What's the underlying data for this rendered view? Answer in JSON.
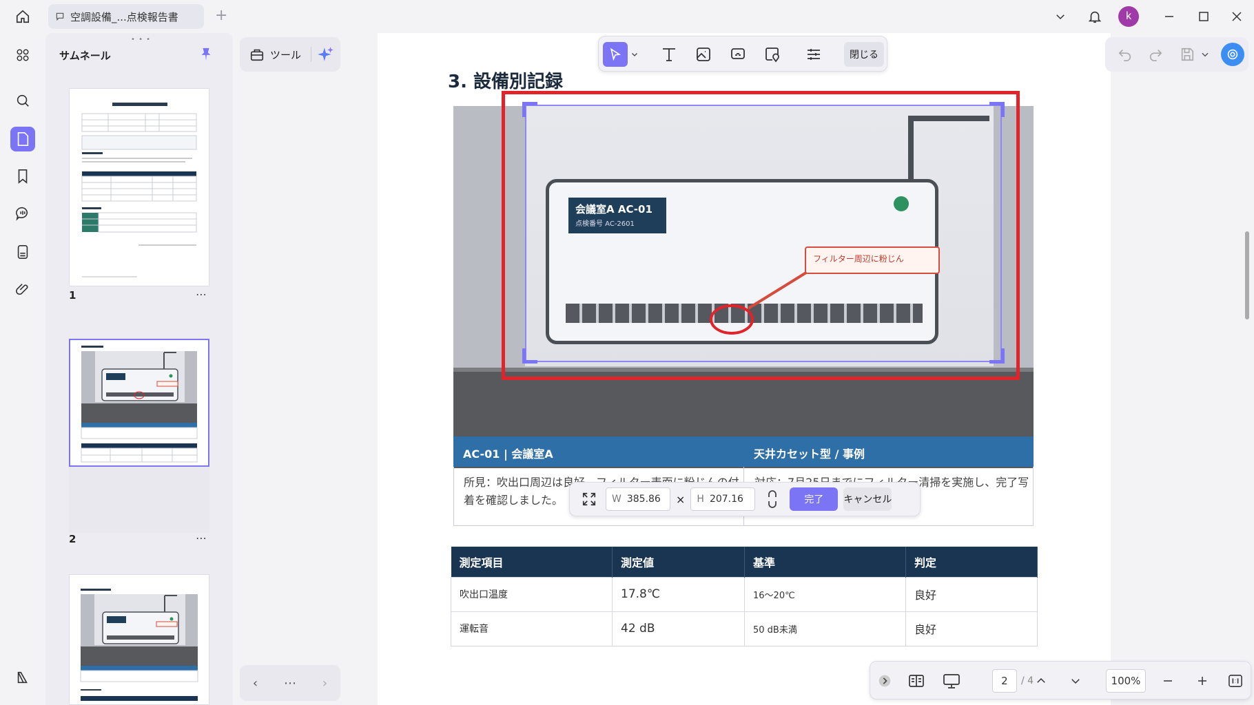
{
  "titlebar": {
    "tab_title": "空調設備_...点検報告書",
    "avatar_letter": "k"
  },
  "thumbnails": {
    "title": "サムネール",
    "pages": [
      {
        "num": "1"
      },
      {
        "num": "2"
      }
    ]
  },
  "tools": {
    "label": "ツール"
  },
  "edit_toolbar": {
    "close_label": "閉じる"
  },
  "document": {
    "section_title": "3.  設備別記録",
    "ac_label_title": "会議室A  AC-01",
    "ac_label_sub": "点検番号  AC-2601",
    "callout": "フィルター周辺に粉じん",
    "record": {
      "head_left": "AC-01 | 会議室A",
      "head_right": "天井カセット型 / 事例",
      "finding": "所見：吹出口周辺は良好。フィルター表面に粉じんの付着を確認しました。",
      "action": "対応：7月25日までにフィルター清掃を実施し、完了写真を台帳へ登録します。"
    },
    "measurements": {
      "headers": [
        "測定項目",
        "測定値",
        "基準",
        "判定"
      ],
      "rows": [
        [
          "吹出口温度",
          "17.8℃",
          "16〜20℃",
          "良好"
        ],
        [
          "運転音",
          "42 dB",
          "50 dB未満",
          "良好"
        ]
      ]
    }
  },
  "resize": {
    "w_key": "W",
    "w_value": "385.86",
    "h_key": "H",
    "h_value": "207.16",
    "times": "×",
    "done_label": "完了",
    "cancel_label": "キャンセル"
  },
  "navigation": {
    "current_page": "2",
    "total_pages": "/ 4",
    "zoom": "100%"
  },
  "colors": {
    "accent": "#7b74f5",
    "selection_red": "#e0242a",
    "table_header": "#1a3551",
    "record_header": "#2f6fa7"
  }
}
